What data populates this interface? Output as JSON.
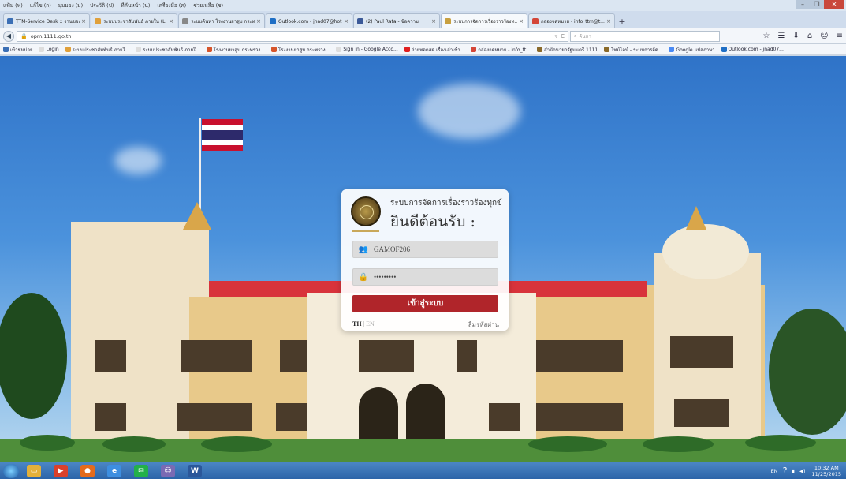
{
  "browser": {
    "menu": [
      "แฟ้ม (ฟ)",
      "แก้ไข (ก)",
      "มุมมอง (ม)",
      "ประวัติ (ป)",
      "ที่คั่นหน้า (น)",
      "เครื่องมือ (ค)",
      "ช่วยเหลือ (ช)"
    ],
    "window_controls": [
      "–",
      "❐",
      "✕"
    ],
    "tabs": [
      {
        "title": "TTM-Service Desk :: งานของฉัน",
        "color": "#3b6fb5",
        "active": false
      },
      {
        "title": "ระบบประชาสัมพันธ์ ภายใน (L...",
        "color": "#e0a03a",
        "active": false
      },
      {
        "title": "ระบบค้นหา โรงงานยาสูบ กระทรว...",
        "color": "#888888",
        "active": false
      },
      {
        "title": "Outlook.com - jnad07@hot...",
        "color": "#1f6fc5",
        "active": false
      },
      {
        "title": "(2) Paul Rata - ข้อความ",
        "color": "#3b5998",
        "active": false
      },
      {
        "title": "ระบบการจัดการเรื่องราวร้องท...",
        "color": "#c8a040",
        "active": true
      },
      {
        "title": "กล่องจดหมาย - info_ttm@t...",
        "color": "#d44638",
        "active": false
      }
    ],
    "new_tab": "+",
    "url": "opm.1111.go.th",
    "url_lock": "🔒",
    "url_reload": "C",
    "url_dropdown": "▿",
    "search_placeholder": "ค้นหา",
    "nav_icons": [
      "☆",
      "☰",
      "⬇",
      "⌂",
      "☺",
      "≡"
    ],
    "back_icon": "◀",
    "bookmarks": [
      {
        "label": "เข้าชมบ่อย",
        "color": "#3b6fb5"
      },
      {
        "label": "Login",
        "color": "#dddddd"
      },
      {
        "label": "ระบบประชาสัมพันธ์ ภายใ...",
        "color": "#e0a03a"
      },
      {
        "label": "ระบบประชาสัมพันธ์ ภายใ...",
        "color": "#dddddd"
      },
      {
        "label": "โรงงานยาสูบ กระทรวง...",
        "color": "#d6552b"
      },
      {
        "label": "โรงงานยาสูบ กระทรวง...",
        "color": "#d6552b"
      },
      {
        "label": "Sign in - Google Acco...",
        "color": "#dddddd"
      },
      {
        "label": "ถ่ายทอดสด เรื่องเล่าเช้า...",
        "color": "#e02020"
      },
      {
        "label": "กล่องจดหมาย - info_tt...",
        "color": "#d44638"
      },
      {
        "label": "สำนักนายกรัฐมนตรี 1111",
        "color": "#8a6a2a"
      },
      {
        "label": "ไทม์ไลน์ - ระบบการจัด...",
        "color": "#8a6a2a"
      },
      {
        "label": "Google แปลภาษา",
        "color": "#4a8af4"
      },
      {
        "label": "Outlook.com - jnad07...",
        "color": "#1f6fc5"
      }
    ]
  },
  "login": {
    "system_title": "ระบบการจัดการเรื่องราวร้องทุกข์",
    "welcome": "ยินดีต้อนรับ :",
    "username_icon": "👥",
    "username_value": "GAMOF206",
    "password_icon": "🔒",
    "password_value": "•••••••••",
    "login_button": "เข้าสู่ระบบ",
    "lang_th": "TH",
    "lang_sep": "|",
    "lang_en": "EN",
    "forgot_password": "ลืมรหัสผ่าน"
  },
  "taskbar": {
    "apps": [
      {
        "name": "explorer",
        "color": "#e3b03a",
        "glyph": "▭"
      },
      {
        "name": "media",
        "color": "#d9402b",
        "glyph": "▶"
      },
      {
        "name": "firefox",
        "color": "#e46b1c",
        "glyph": "●"
      },
      {
        "name": "ie",
        "color": "#3d8ee0",
        "glyph": "e"
      },
      {
        "name": "line",
        "color": "#22b04a",
        "glyph": "✉"
      },
      {
        "name": "people",
        "color": "#7a6ab3",
        "glyph": "☺"
      },
      {
        "name": "word",
        "color": "#2b579a",
        "glyph": "W"
      }
    ],
    "lang": "EN",
    "time": "10:32 AM",
    "date": "11/25/2015"
  }
}
